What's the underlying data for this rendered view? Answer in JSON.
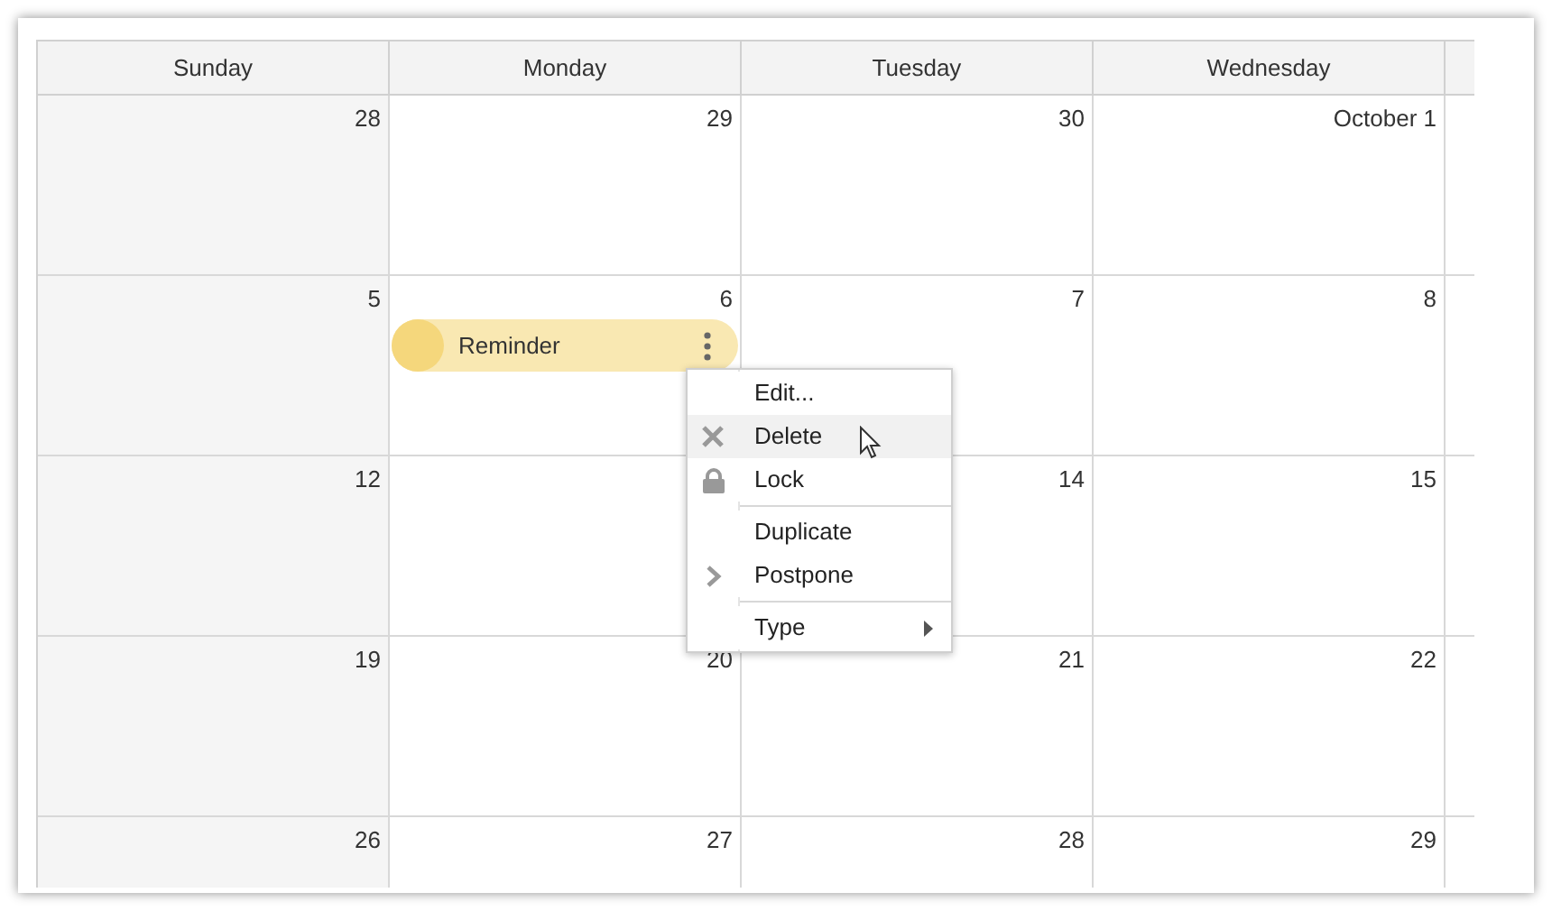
{
  "columns": [
    {
      "label": "Sunday",
      "kind": "weekend"
    },
    {
      "label": "Monday",
      "kind": "weekday"
    },
    {
      "label": "Tuesday",
      "kind": "weekday"
    },
    {
      "label": "Wednesday",
      "kind": "weekday"
    }
  ],
  "weeks": [
    {
      "sunday": {
        "number": "28"
      },
      "monday": {
        "number": "29"
      },
      "tuesday": {
        "number": "30"
      },
      "wednesday": {
        "number": "October 1"
      }
    },
    {
      "sunday": {
        "number": "5"
      },
      "monday": {
        "number": "6",
        "events": [
          {
            "text": "Reminder"
          }
        ]
      },
      "tuesday": {
        "number": "7"
      },
      "wednesday": {
        "number": "8"
      }
    },
    {
      "sunday": {
        "number": "12"
      },
      "tuesday": {
        "number": "14"
      },
      "wednesday": {
        "number": "15"
      }
    },
    {
      "sunday": {
        "number": "19"
      },
      "monday": {
        "number": "20"
      },
      "tuesday": {
        "number": "21"
      },
      "wednesday": {
        "number": "22"
      }
    },
    {
      "sunday": {
        "number": "26"
      },
      "monday": {
        "number": "27"
      },
      "tuesday": {
        "number": "28"
      },
      "wednesday": {
        "number": "29"
      }
    }
  ],
  "context_menu": {
    "items": [
      {
        "kind": "plain",
        "label": "Edit...",
        "selected": false
      },
      {
        "kind": "delete",
        "label": "Delete",
        "selected": true
      },
      {
        "kind": "lock",
        "label": "Lock",
        "selected": false
      },
      {
        "kind": "separator"
      },
      {
        "kind": "plain",
        "label": "Duplicate",
        "selected": false
      },
      {
        "kind": "postpone",
        "label": "Postpone",
        "selected": false
      },
      {
        "kind": "separator"
      },
      {
        "kind": "submenu",
        "label": "Type",
        "selected": false
      }
    ]
  }
}
